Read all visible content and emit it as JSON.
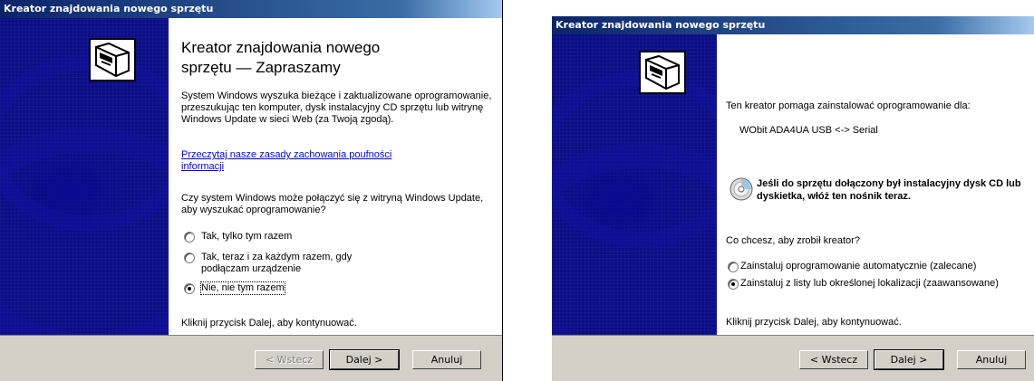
{
  "left": {
    "title": "Kreator znajdowania nowego sprzętu",
    "heading_line1": "Kreator znajdowania nowego",
    "heading_line2": "sprzętu — Zapraszamy",
    "intro": "System Windows wyszuka bieżące i zaktualizowane oprogramowanie, przeszukując ten komputer, dysk instalacyjny CD sprzętu lub witrynę Windows Update w sieci Web (za Twoją zgodą).",
    "privacy_link": "Przeczytaj nasze zasady zachowania poufności informacji",
    "question": "Czy system Windows może połączyć się z witryną Windows Update, aby wyszukać oprogramowanie?",
    "options": [
      {
        "label": "Tak, tylko tym razem",
        "checked": false
      },
      {
        "label": "Tak, teraz i za każdym razem, gdy podłączam urządzenie",
        "checked": false
      },
      {
        "label": "Nie, nie tym razem",
        "checked": true
      }
    ],
    "footer_text": "Kliknij przycisk Dalej, aby kontynuować.",
    "buttons": {
      "back": "< Wstecz",
      "next": "Dalej >",
      "cancel": "Anuluj"
    }
  },
  "right": {
    "title": "Kreator znajdowania nowego sprzętu",
    "intro": "Ten kreator pomaga zainstalować oprogramowanie dla:",
    "device": "WObit ADA4UA USB <-> Serial",
    "cd_note": "Jeśli do sprzętu dołączony był instalacyjny dysk CD lub dyskietka, włóż ten nośnik teraz.",
    "question": "Co chcesz, aby zrobił kreator?",
    "options": [
      {
        "label": "Zainstaluj oprogramowanie automatycznie (zalecane)",
        "checked": false
      },
      {
        "label": "Zainstaluj z listy lub określonej lokalizacji (zaawansowane)",
        "checked": true
      }
    ],
    "footer_text": "Kliknij przycisk Dalej, aby kontynuować.",
    "buttons": {
      "back": "< Wstecz",
      "next": "Dalej >",
      "cancel": "Anuluj"
    }
  },
  "icons": {
    "hardware": "hardware-card-icon",
    "cd": "cd-disc-icon"
  },
  "colors": {
    "titlebar": "#0a246a",
    "sidepanel": "#0b0d86",
    "face": "#d4d0c8",
    "link": "#0000ff"
  }
}
